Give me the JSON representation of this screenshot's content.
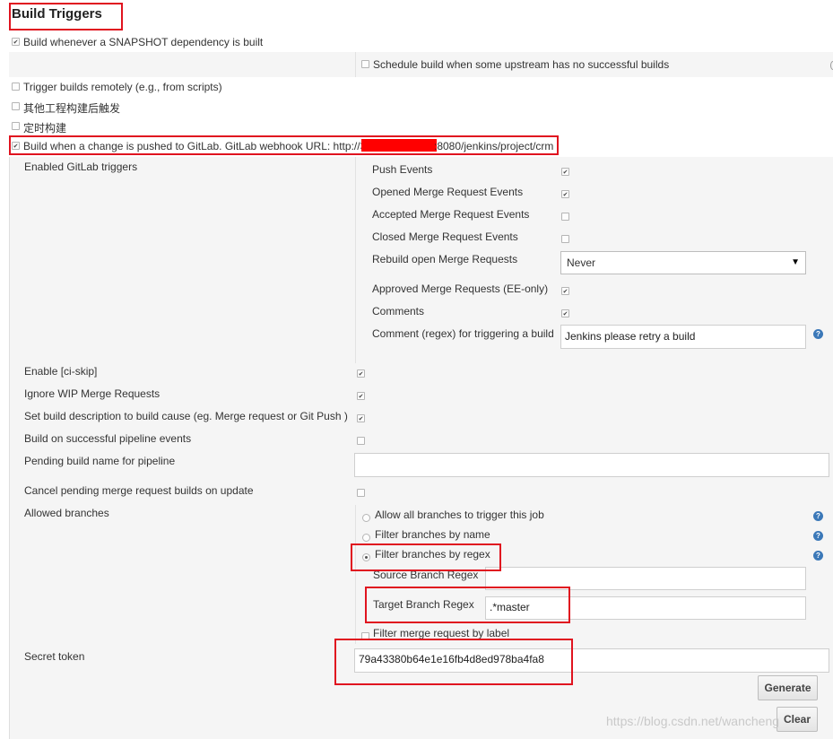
{
  "section_title": "Build Triggers",
  "triggers": {
    "snapshot_dependency": {
      "label": "Build whenever a SNAPSHOT dependency is built",
      "checked": true
    },
    "schedule_upstream": {
      "label": "Schedule build when some upstream has no successful builds",
      "checked": false
    },
    "trigger_remotely": {
      "label": "Trigger builds remotely (e.g., from scripts)",
      "checked": false
    },
    "after_other_projects": {
      "label": "其他工程构建后触发",
      "checked": false
    },
    "periodic_build": {
      "label": "定时构建",
      "checked": false
    },
    "gitlab_push": {
      "label_prefix": "Build when a change is pushed to GitLab. GitLab webhook URL: http://3",
      "label_suffix": ":8080/jenkins/project/crm",
      "checked": true
    }
  },
  "gitlab": {
    "enabled_triggers_label": "Enabled GitLab triggers",
    "events": [
      {
        "label": "Push Events",
        "checked": true
      },
      {
        "label": "Opened Merge Request Events",
        "checked": true
      },
      {
        "label": "Accepted Merge Request Events",
        "checked": false
      },
      {
        "label": "Closed Merge Request Events",
        "checked": false
      }
    ],
    "rebuild_label": "Rebuild open Merge Requests",
    "rebuild_value": "Never",
    "approved_mr": {
      "label": "Approved Merge Requests (EE-only)",
      "checked": true
    },
    "comments": {
      "label": "Comments",
      "checked": true
    },
    "comment_regex_label": "Comment (regex) for triggering a build",
    "comment_regex_value": "Jenkins please retry a build",
    "options": [
      {
        "label": "Enable [ci-skip]",
        "checked": true
      },
      {
        "label": "Ignore WIP Merge Requests",
        "checked": true
      },
      {
        "label": "Set build description to build cause (eg. Merge request or Git Push )",
        "checked": true
      },
      {
        "label": "Build on successful pipeline events",
        "checked": false
      }
    ],
    "pending_build_label": "Pending build name for pipeline",
    "pending_build_value": "",
    "cancel_pending": {
      "label": "Cancel pending merge request builds on update",
      "checked": false
    },
    "allowed_branches_label": "Allowed branches",
    "branch_modes": [
      {
        "label": "Allow all branches to trigger this job",
        "selected": false
      },
      {
        "label": "Filter branches by name",
        "selected": false
      },
      {
        "label": "Filter branches by regex",
        "selected": true
      }
    ],
    "source_regex_label": "Source Branch Regex",
    "source_regex_value": "",
    "target_regex_label": "Target Branch Regex",
    "target_regex_value": ".*master",
    "filter_by_label": {
      "label": "Filter merge request by label",
      "checked": false
    },
    "secret_token_label": "Secret token",
    "secret_token_value": "79a43380b64e1e16fb4d8ed978ba4fa8",
    "generate_label": "Generate",
    "clear_label": "Clear"
  },
  "watermark": "https://blog.csdn.net/wancheng",
  "colors": {
    "highlight_box": "#e0131f",
    "redaction": "#ff0000",
    "help_icon": "#3b78b8"
  }
}
